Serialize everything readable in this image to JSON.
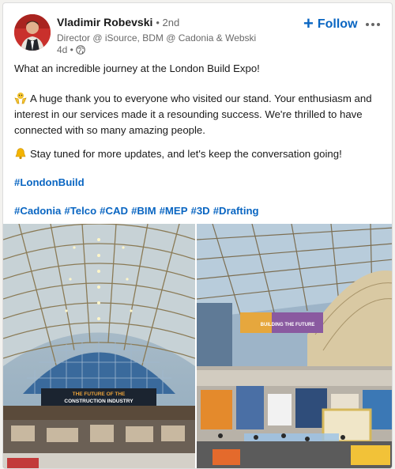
{
  "author": {
    "name": "Vladimir Robevski",
    "degree": "• 2nd",
    "headline": "Director @ iSource, BDM @ Cadonia & Webski",
    "time": "4d •"
  },
  "actions": {
    "follow_label": "Follow",
    "follow_icon": "plus-icon",
    "more_icon": "more-icon"
  },
  "post": {
    "intro": "What an incredible journey at the London Build Expo!",
    "thanks_emoji": "hands-icon",
    "thanks": "A huge thank you to everyone who visited our stand. Your enthusiasm and interest in our services made it a resounding success. We're thrilled to have connected with so many amazing people.",
    "stay_emoji": "bell-icon",
    "stay": "Stay tuned for more updates, and let's keep the conversation going!",
    "hashtag_main": "#LondonBuild",
    "hashtags": [
      "#Cadonia",
      "#Telco",
      "#CAD",
      "#BIM",
      "#MEP",
      "#3D",
      "#Drafting"
    ]
  },
  "images": {
    "left_banner": "THE FUTURE OF THE CONSTRUCTION INDUSTRY",
    "right_banner": "BUILDING THE FUTURE"
  },
  "colors": {
    "link": "#0a66c2",
    "text": "rgba(0,0,0,0.9)",
    "muted": "rgba(0,0,0,0.6)"
  }
}
